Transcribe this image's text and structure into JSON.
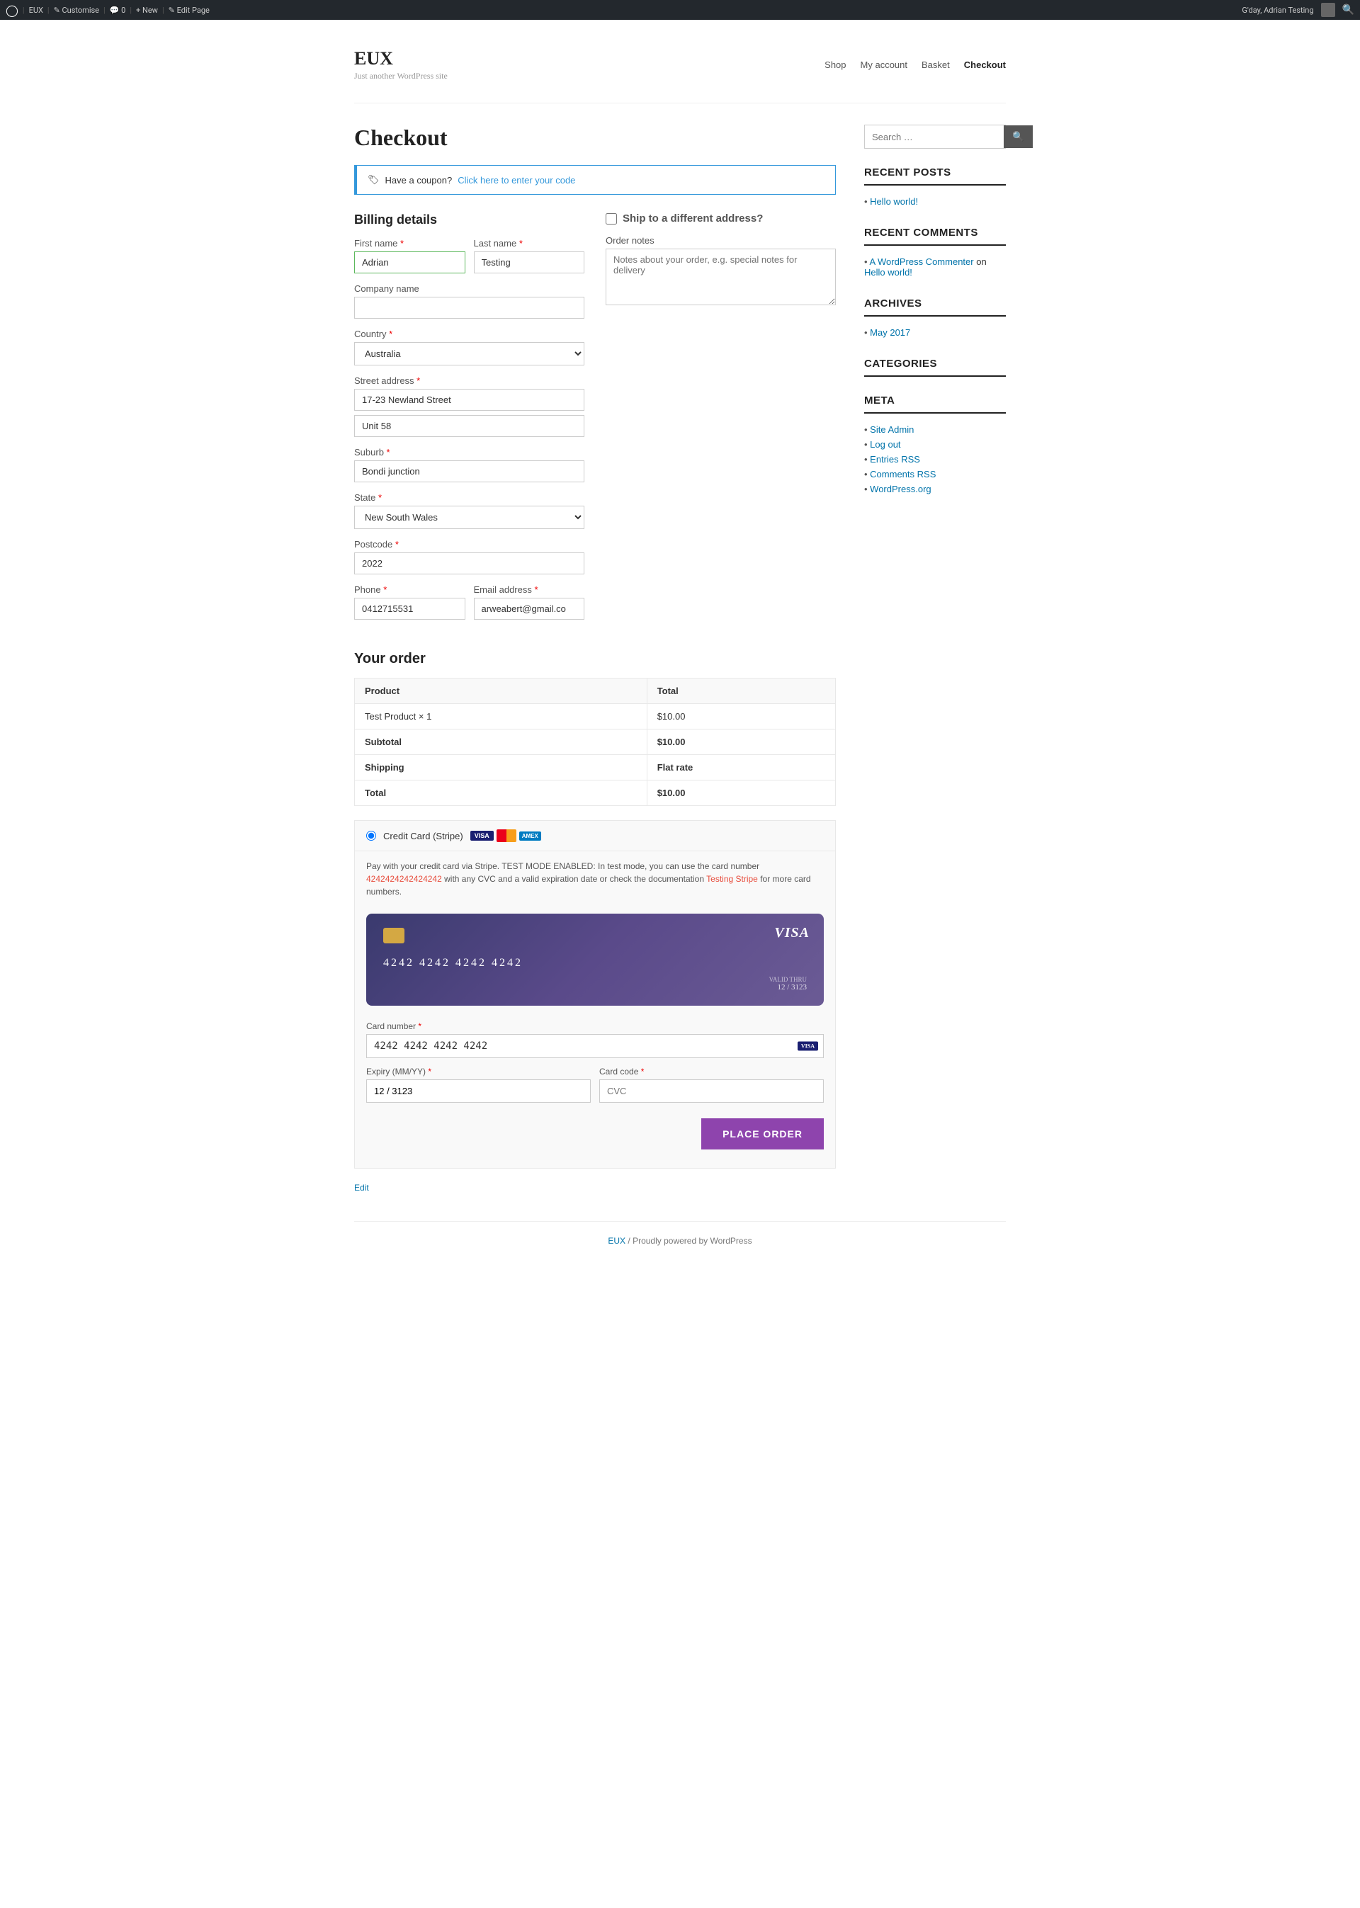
{
  "admin_bar": {
    "wp_label": "W",
    "site_name": "EUX",
    "customize_label": "Customise",
    "comments_label": "0",
    "new_label": "New",
    "edit_page_label": "Edit Page",
    "greeting": "G'day, Adrian Testing",
    "search_tooltip": "Search"
  },
  "site": {
    "title": "EUX",
    "tagline": "Just another WordPress site"
  },
  "nav": {
    "items": [
      {
        "label": "Shop",
        "url": "#",
        "active": false
      },
      {
        "label": "My account",
        "url": "#",
        "active": false
      },
      {
        "label": "Basket",
        "url": "#",
        "active": false
      },
      {
        "label": "Checkout",
        "url": "#",
        "active": true
      }
    ]
  },
  "page_title": "Checkout",
  "coupon": {
    "icon": "🏷",
    "text": "Have a coupon?",
    "link_text": "Click here to enter your code"
  },
  "billing": {
    "section_title": "Billing details",
    "first_name_label": "First name",
    "first_name_value": "Adrian",
    "last_name_label": "Last name",
    "last_name_value": "Testing",
    "company_label": "Company name",
    "company_value": "",
    "country_label": "Country",
    "country_value": "Australia",
    "street_label": "Street address",
    "street_value": "17-23 Newland Street",
    "street2_value": "Unit 58",
    "suburb_label": "Suburb",
    "suburb_value": "Bondi junction",
    "state_label": "State",
    "state_value": "New South Wales",
    "postcode_label": "Postcode",
    "postcode_value": "2022",
    "phone_label": "Phone",
    "phone_value": "0412715531",
    "email_label": "Email address",
    "email_value": "arweabert@gmail.co"
  },
  "shipping": {
    "checkbox_label": "Ship to a different address?"
  },
  "order_notes": {
    "label": "Order notes",
    "placeholder": "Notes about your order, e.g. special notes for delivery"
  },
  "your_order": {
    "title": "Your order",
    "col_product": "Product",
    "col_total": "Total",
    "items": [
      {
        "name": "Test Product",
        "qty": "× 1",
        "total": "$10.00"
      }
    ],
    "subtotal_label": "Subtotal",
    "subtotal_value": "$10.00",
    "shipping_label": "Shipping",
    "shipping_value": "Flat rate",
    "total_label": "Total",
    "total_value": "$10.00"
  },
  "payment": {
    "method_label": "Credit Card (Stripe)",
    "stripe_info": "Pay with your credit card via Stripe. TEST MODE ENABLED: In test mode, you can use the card number",
    "card_number_link": "4242424242424242",
    "stripe_info2": "with any CVC and a valid expiration date or check the documentation",
    "testing_stripe_label": "Testing Stripe",
    "stripe_info3": "for more card numbers.",
    "cc_number_display": "4242 4242 4242 4242",
    "cc_expiry_display": "12 / 3123",
    "cc_expiry_label_text": "VALID THRU",
    "visa_logo": "VISA",
    "card_number_label": "Card number",
    "card_number_value": "4242 4242 4242 4242",
    "expiry_label": "Expiry (MM/YY)",
    "expiry_value": "12 / 3123",
    "cvc_label": "Card code",
    "cvc_placeholder": "CVC",
    "place_order_label": "PLACE ORDER"
  },
  "sidebar": {
    "search_placeholder": "Search …",
    "recent_posts_title": "RECENT POSTS",
    "recent_posts": [
      {
        "label": "Hello world!"
      }
    ],
    "recent_comments_title": "RECENT COMMENTS",
    "recent_comments": [
      {
        "author": "A WordPress Commenter",
        "on": "on",
        "post": "Hello world!"
      }
    ],
    "archives_title": "ARCHIVES",
    "archives": [
      {
        "label": "May 2017"
      }
    ],
    "categories_title": "CATEGORIES",
    "categories": [],
    "meta_title": "META",
    "meta_items": [
      {
        "label": "Site Admin"
      },
      {
        "label": "Log out"
      },
      {
        "label": "Entries RSS"
      },
      {
        "label": "Comments RSS"
      },
      {
        "label": "WordPress.org"
      }
    ]
  },
  "footer": {
    "site": "EUX",
    "separator": "/",
    "powered_by": "Proudly powered by WordPress"
  },
  "edit_link": "Edit"
}
